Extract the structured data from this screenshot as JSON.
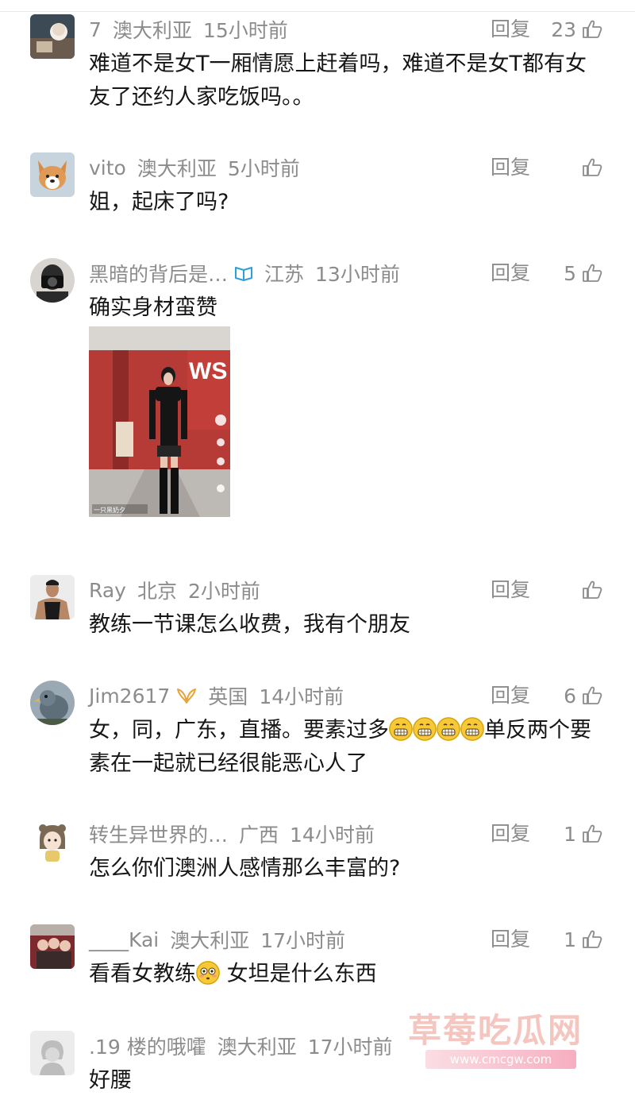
{
  "comments": [
    {
      "user": "7",
      "badge": "",
      "location": "澳大利亚",
      "time": "15小时前",
      "reply": "回复",
      "likes": "23",
      "text": "难道不是女T一厢情愿上赶着吗，难道不是女T都有女友了还约人家吃饭吗。。",
      "avatar": "cartoon-avatar-icon"
    },
    {
      "user": "vito",
      "badge": "",
      "location": "澳大利亚",
      "time": "5小时前",
      "reply": "回复",
      "likes": "",
      "text": "姐，起床了吗?",
      "avatar": "corgi-avatar-icon"
    },
    {
      "user": "黑暗的背后是…",
      "badge": "book-icon",
      "location": "江苏",
      "time": "13小时前",
      "reply": "回复",
      "likes": "5",
      "text": "确实身材蛮赞",
      "avatar": "camera-person-avatar-icon",
      "has_photo": true
    },
    {
      "user": "Ray",
      "badge": "",
      "location": "北京",
      "time": "2小时前",
      "reply": "回复",
      "likes": "",
      "text": "教练一节课怎么收费，我有个朋友",
      "avatar": "fitness-man-avatar-icon"
    },
    {
      "user": "Jim2617",
      "badge": "wings-icon",
      "location": "英国",
      "time": "14小时前",
      "reply": "回复",
      "likes": "6",
      "text_a": "女，同，广东，直播。要素过多",
      "text_b": "单反两个要素在一起就已经很能恶心人了",
      "avatar": "bird-avatar-icon"
    },
    {
      "user": "转生异世界的…",
      "badge": "",
      "location": "广西",
      "time": "14小时前",
      "reply": "回复",
      "likes": "1",
      "text": "怎么你们澳洲人感情那么丰富的?",
      "avatar": "anime-girl-avatar-icon"
    },
    {
      "user": "____Kai",
      "badge": "",
      "location": "澳大利亚",
      "time": "17小时前",
      "reply": "回复",
      "likes": "1",
      "text_a": "看看女教练",
      "text_b": " 女坦是什么东西",
      "avatar": "group-photo-avatar-icon"
    },
    {
      "user": ".19 楼的哦嚯",
      "badge": "",
      "location": "澳大利亚",
      "time": "17小时前",
      "reply": "回复",
      "likes": "",
      "text": "好腰",
      "avatar": "default-avatar-icon"
    }
  ],
  "photo": {
    "sign_text": "WS",
    "footer_tag": "一只黑奶夕"
  },
  "watermark": {
    "title": "草莓吃瓜网",
    "url": "www.cmcgw.com"
  }
}
